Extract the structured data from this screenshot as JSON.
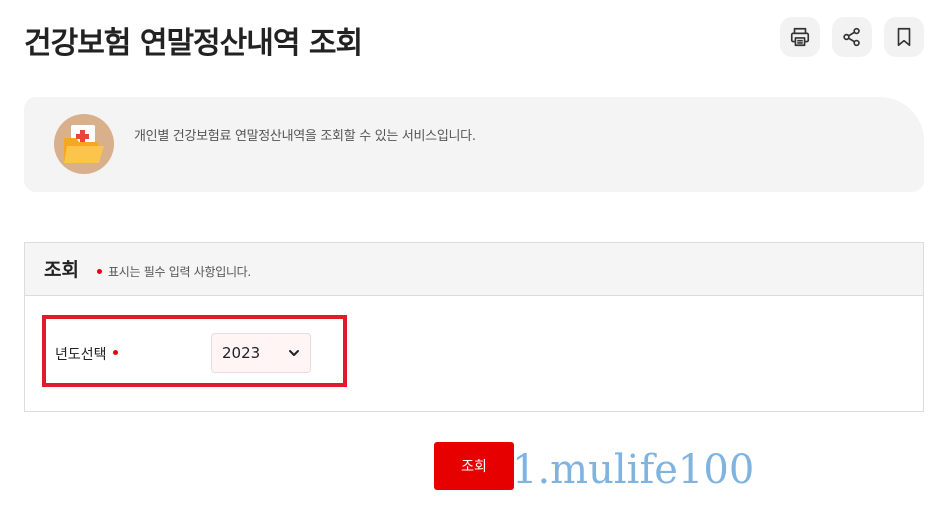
{
  "header": {
    "title": "건강보험 연말정산내역 조회",
    "tools": [
      {
        "label": "print",
        "icon": "printer-icon"
      },
      {
        "label": "share",
        "icon": "share-icon"
      },
      {
        "label": "bookmark",
        "icon": "bookmark-icon"
      }
    ]
  },
  "info": {
    "icon": "medical-folder-icon",
    "text": "개인별 건강보험료 연말정산내역을 조회할 수 있는 서비스입니다."
  },
  "search_panel": {
    "title": "조회",
    "required_note": "표시는 필수 입력 사항입니다.",
    "fields": [
      {
        "label": "년도선택",
        "required": true,
        "selected": "2023"
      }
    ],
    "highlight_color": "#e21b2b"
  },
  "actions": {
    "submit_label": "조회"
  },
  "watermark": "1.mulife100",
  "colors": {
    "accent": "#e60000",
    "required": "#e60012",
    "watermark": "#7fb3e0"
  }
}
